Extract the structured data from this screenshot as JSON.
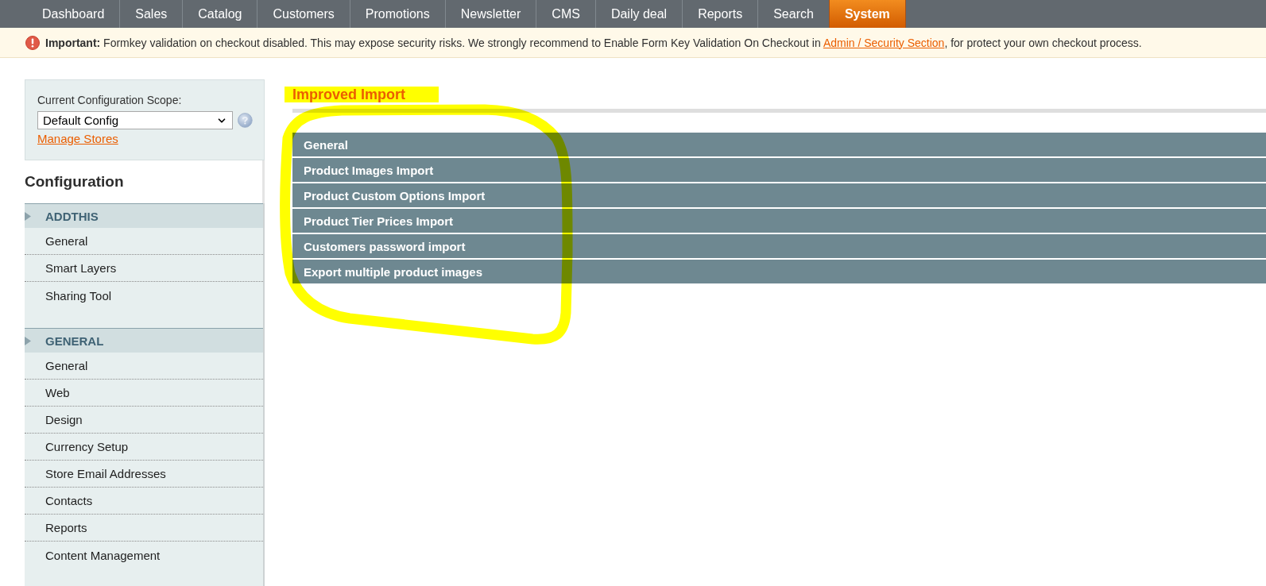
{
  "nav": {
    "tabs": [
      {
        "label": "Dashboard",
        "selected": false
      },
      {
        "label": "Sales",
        "selected": false
      },
      {
        "label": "Catalog",
        "selected": false
      },
      {
        "label": "Customers",
        "selected": false
      },
      {
        "label": "Promotions",
        "selected": false
      },
      {
        "label": "Newsletter",
        "selected": false
      },
      {
        "label": "CMS",
        "selected": false
      },
      {
        "label": "Daily deal",
        "selected": false
      },
      {
        "label": "Reports",
        "selected": false
      },
      {
        "label": "Search",
        "selected": false
      },
      {
        "label": "System",
        "selected": true
      }
    ]
  },
  "notice": {
    "text": "**Important:** Formkey validation on checkout disabled. This may expose security risks. We strongly recommend to Enable Form Key Validation On Checkout in",
    "link": "Admin / Security Section",
    "text_after": ", for protect your own checkout process."
  },
  "scope": {
    "label": "Current Configuration Scope:",
    "value": "Default Config",
    "link": "Manage Stores"
  },
  "sidebar": {
    "title": "Configuration",
    "groups": [
      {
        "label": "ADDTHIS",
        "items": [
          {
            "label": "General"
          },
          {
            "label": "Smart Layers"
          },
          {
            "label": "Sharing Tool"
          }
        ]
      },
      {
        "label": "GENERAL",
        "items": [
          {
            "label": "General"
          },
          {
            "label": "Web"
          },
          {
            "label": "Design"
          },
          {
            "label": "Currency Setup"
          },
          {
            "label": "Store Email Addresses"
          },
          {
            "label": "Contacts"
          },
          {
            "label": "Reports"
          },
          {
            "label": "Content Management"
          }
        ]
      }
    ]
  },
  "main": {
    "title": "Improved Import",
    "sections": [
      {
        "label": "General"
      },
      {
        "label": "Product Images Import"
      },
      {
        "label": "Product Custom Options Import"
      },
      {
        "label": "Product Tier Prices Import"
      },
      {
        "label": "Customers password import"
      },
      {
        "label": "Export multiple product images"
      }
    ]
  }
}
